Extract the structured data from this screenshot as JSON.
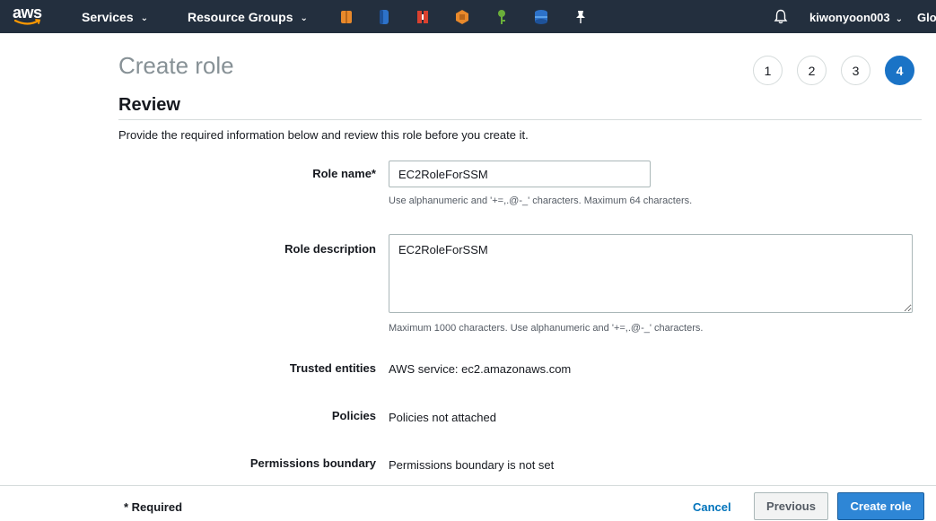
{
  "nav": {
    "logo_text": "aws",
    "services_label": "Services",
    "resource_groups_label": "Resource Groups",
    "user_label": "kiwonyoon003",
    "region_label": "Glol",
    "service_icons": [
      {
        "name": "aws-service-orange-icon",
        "color": "#e8892b"
      },
      {
        "name": "aws-service-blue-icon",
        "color": "#2d72c9"
      },
      {
        "name": "aws-service-red-icon",
        "color": "#d9412f"
      },
      {
        "name": "aws-service-amber-icon",
        "color": "#e8892b"
      },
      {
        "name": "aws-service-key-icon",
        "color": "#6aae3a"
      },
      {
        "name": "aws-service-database-icon",
        "color": "#2d72c9"
      },
      {
        "name": "pin-icon",
        "color": "#ffffff"
      }
    ]
  },
  "header": {
    "title": "Create role",
    "steps": [
      "1",
      "2",
      "3",
      "4"
    ],
    "active_step": "4"
  },
  "review": {
    "title": "Review",
    "intro": "Provide the required information below and review this role before you create it."
  },
  "form": {
    "role_name_label": "Role name*",
    "role_name_value": "EC2RoleForSSM",
    "role_name_hint": "Use alphanumeric and '+=,.@-_' characters. Maximum 64 characters.",
    "role_description_label": "Role description",
    "role_description_value": "EC2RoleForSSM",
    "role_description_hint": "Maximum 1000 characters. Use alphanumeric and '+=,.@-_' characters.",
    "trusted_entities_label": "Trusted entities",
    "trusted_entities_value": "AWS service: ec2.amazonaws.com",
    "policies_label": "Policies",
    "policies_value": "Policies not attached",
    "permissions_boundary_label": "Permissions boundary",
    "permissions_boundary_value": "Permissions boundary is not set"
  },
  "footer": {
    "required_note": "* Required",
    "cancel_label": "Cancel",
    "previous_label": "Previous",
    "create_label": "Create role"
  },
  "colors": {
    "nav_bg": "#232f3e",
    "primary": "#2e86d6",
    "link": "#0073bb"
  }
}
